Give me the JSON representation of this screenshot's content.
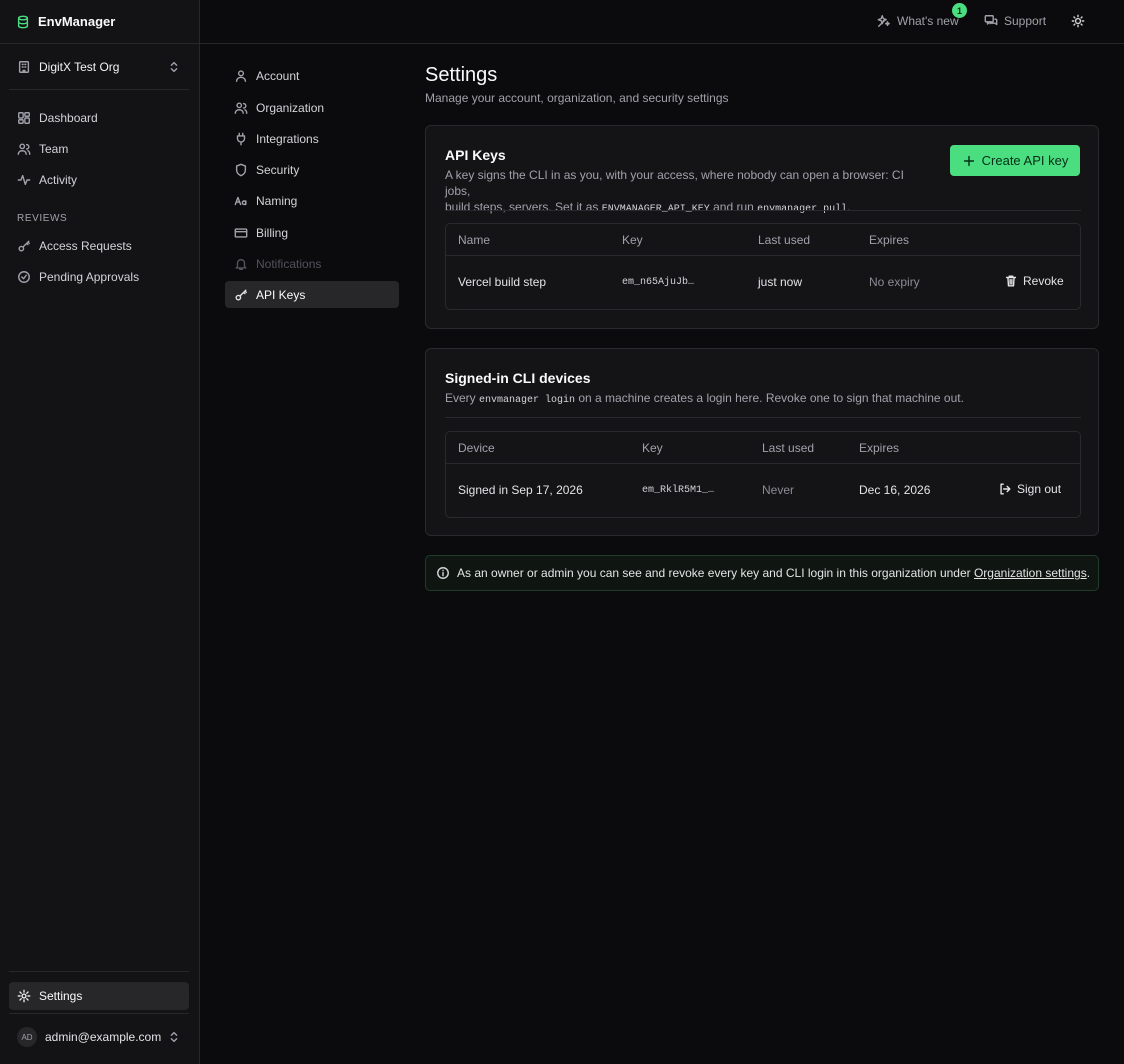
{
  "app": {
    "name": "EnvManager"
  },
  "org": {
    "name": "DigitX Test Org"
  },
  "sidebar": {
    "items": [
      {
        "label": "Dashboard",
        "icon": "dashboard-icon"
      },
      {
        "label": "Team",
        "icon": "team-icon"
      },
      {
        "label": "Activity",
        "icon": "activity-icon"
      }
    ],
    "reviews_label": "REVIEWS",
    "reviews": [
      {
        "label": "Access Requests",
        "icon": "key-icon"
      },
      {
        "label": "Pending Approvals",
        "icon": "check-circle-icon"
      }
    ],
    "settings_label": "Settings",
    "user_initials": "AD",
    "user_email": "admin@example.com"
  },
  "topbar": {
    "whats_new": "What's new",
    "whats_new_count": "1",
    "support": "Support"
  },
  "settings_nav": [
    {
      "label": "Account",
      "icon": "user-icon"
    },
    {
      "label": "Organization",
      "icon": "users-icon"
    },
    {
      "label": "Integrations",
      "icon": "plug-icon"
    },
    {
      "label": "Security",
      "icon": "shield-icon"
    },
    {
      "label": "Naming",
      "icon": "naming-icon"
    },
    {
      "label": "Billing",
      "icon": "credit-card-icon"
    },
    {
      "label": "Notifications",
      "icon": "bell-icon",
      "disabled": true
    },
    {
      "label": "API Keys",
      "icon": "key-icon",
      "active": true
    }
  ],
  "page": {
    "title": "Settings",
    "subtitle": "Manage your account, organization, and security settings"
  },
  "api_keys": {
    "title": "API Keys",
    "desc_1": "A key signs the CLI in as you, with your access, where nobody can open a browser: CI jobs,",
    "desc_2a": "build steps, servers. Set it as ",
    "desc_2_code1": "ENVMANAGER_API_KEY",
    "desc_2b": " and run ",
    "desc_2_code2": "envmanager pull",
    "desc_2c": ".",
    "create_label": "Create API key",
    "columns": [
      "Name",
      "Key",
      "Last used",
      "Expires"
    ],
    "rows": [
      {
        "name": "Vercel build step",
        "key": "em_n65AjuJb…",
        "last_used": "just now",
        "expires": "No expiry",
        "action": "Revoke"
      }
    ]
  },
  "cli_devices": {
    "title": "Signed-in CLI devices",
    "desc_a": "Every ",
    "desc_code": "envmanager login",
    "desc_b": " on a machine creates a login here. Revoke one to sign that machine out.",
    "columns": [
      "Device",
      "Key",
      "Last used",
      "Expires"
    ],
    "rows": [
      {
        "device": "Signed in Sep 17, 2026",
        "key": "em_RklR5M1_…",
        "last_used": "Never",
        "expires": "Dec 16, 2026",
        "action": "Sign out"
      }
    ]
  },
  "notice": {
    "text": "As an owner or admin you can see and revoke every key and CLI login in this organization under ",
    "link": "Organization settings",
    "end": "."
  },
  "colors": {
    "accent": "#4ade80",
    "background": "#0b0b0d",
    "sidebar": "#131316"
  }
}
